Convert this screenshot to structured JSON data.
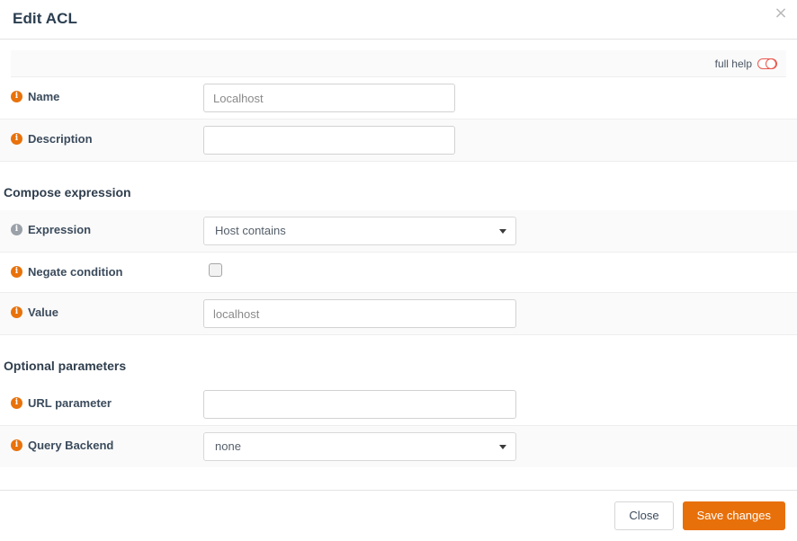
{
  "dialog": {
    "title": "Edit ACL",
    "close_icon": "close-icon",
    "close_glyph": "×"
  },
  "help_bar": {
    "label": "full help",
    "toggle_state": "off",
    "toggle_color": "#e8584f"
  },
  "info_icon_glyph": "i",
  "fields": {
    "name": {
      "label": "Name",
      "value": "Localhost",
      "placeholder": "",
      "icon_color": "orange"
    },
    "description": {
      "label": "Description",
      "value": "",
      "placeholder": "",
      "icon_color": "orange"
    },
    "expression": {
      "label": "Expression",
      "selected": "Host contains",
      "icon_color": "gray"
    },
    "negate_condition": {
      "label": "Negate condition",
      "checked": false,
      "icon_color": "orange"
    },
    "value": {
      "label": "Value",
      "value": "localhost",
      "placeholder": "",
      "icon_color": "orange"
    },
    "url_parameter": {
      "label": "URL parameter",
      "value": "",
      "placeholder": "",
      "icon_color": "orange"
    },
    "query_backend": {
      "label": "Query Backend",
      "selected": "none",
      "icon_color": "orange"
    }
  },
  "sections": {
    "compose_expression": "Compose expression",
    "optional_parameters": "Optional parameters"
  },
  "footer": {
    "close_label": "Close",
    "save_label": "Save changes",
    "primary_color": "#e8700a"
  }
}
